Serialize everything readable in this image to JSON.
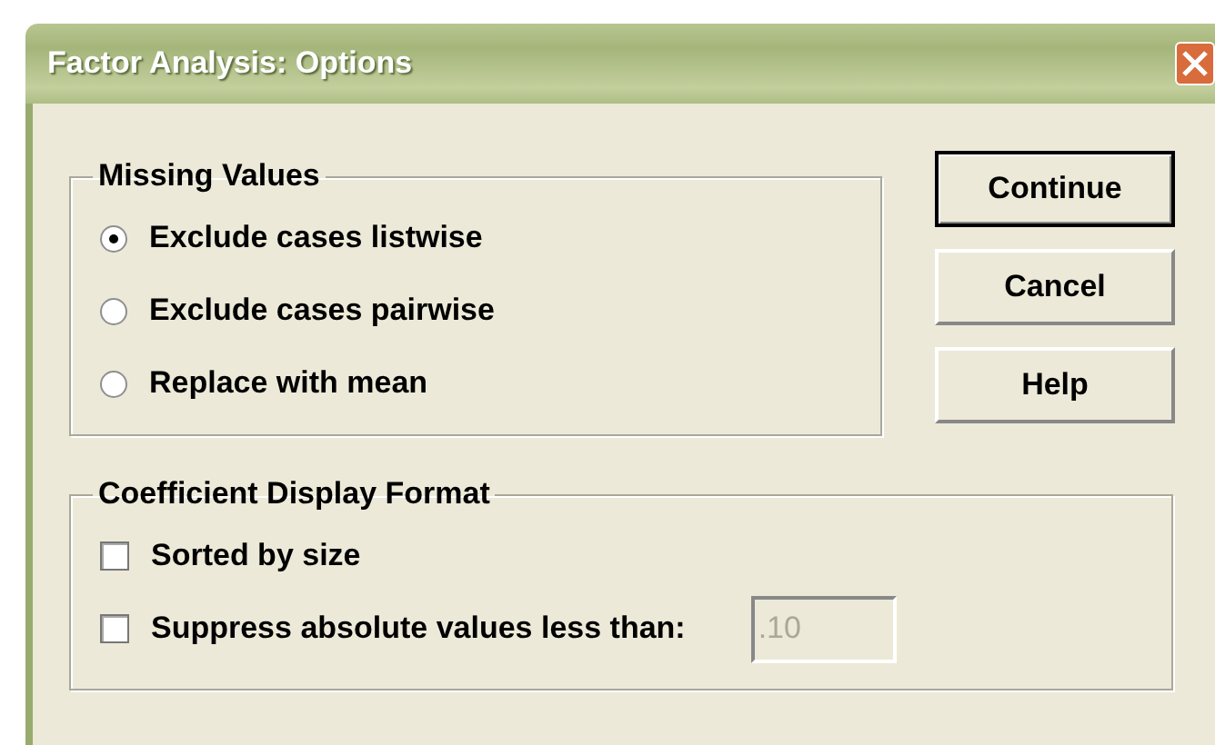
{
  "window": {
    "title": "Factor Analysis: Options"
  },
  "missing_values": {
    "title": "Missing Values",
    "options": [
      {
        "label": "Exclude cases listwise",
        "selected": true
      },
      {
        "label": "Exclude cases pairwise",
        "selected": false
      },
      {
        "label": "Replace with mean",
        "selected": false
      }
    ]
  },
  "buttons": [
    {
      "label": "Continue",
      "default": true
    },
    {
      "label": "Cancel",
      "default": false
    },
    {
      "label": "Help",
      "default": false
    }
  ],
  "coefficient_display_format": {
    "title": "Coefficient Display Format",
    "sorted_by_size": {
      "label": "Sorted by size",
      "checked": false
    },
    "suppress": {
      "label": "Suppress absolute values less than:",
      "checked": false,
      "value": ".10",
      "disabled": true
    }
  }
}
